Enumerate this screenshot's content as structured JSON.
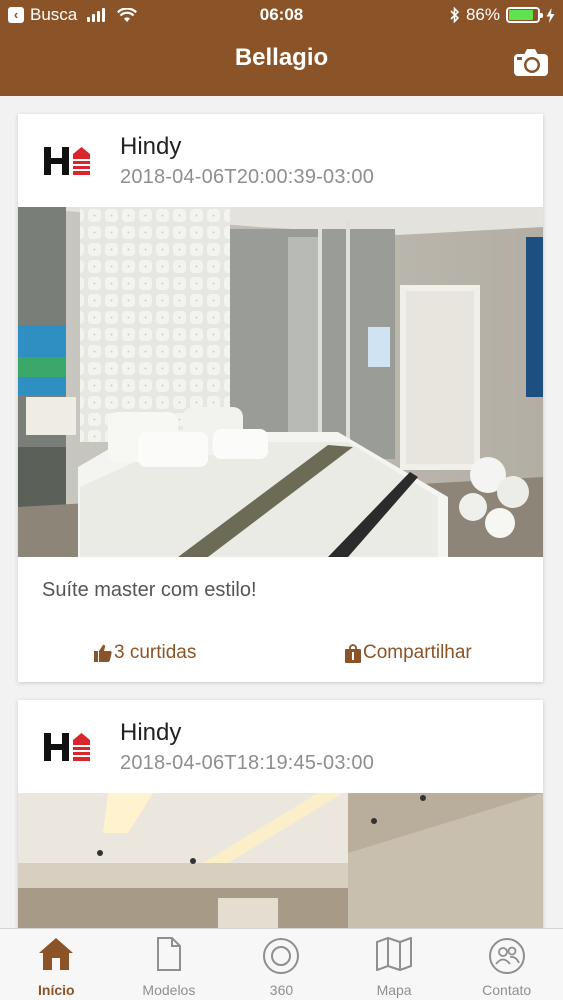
{
  "status_bar": {
    "carrier": "Busca",
    "time": "06:08",
    "battery_percent": "86%",
    "battery_level": 0.86
  },
  "header": {
    "title": "Bellagio",
    "camera_icon": "camera-icon"
  },
  "posts": [
    {
      "author": "Hindy",
      "date": "2018-04-06T20:00:39-03:00",
      "caption": "Suíte master com estilo!",
      "likes_label": "3 curtidas",
      "share_label": "Compartilhar"
    },
    {
      "author": "Hindy",
      "date": "2018-04-06T18:19:45-03:00"
    }
  ],
  "tabs": [
    {
      "label": "Início",
      "icon": "home-icon",
      "active": true
    },
    {
      "label": "Modelos",
      "icon": "document-icon",
      "active": false
    },
    {
      "label": "360",
      "icon": "target-icon",
      "active": false
    },
    {
      "label": "Mapa",
      "icon": "map-icon",
      "active": false
    },
    {
      "label": "Contato",
      "icon": "contacts-icon",
      "active": false
    }
  ],
  "colors": {
    "brand": "#8b5428",
    "background": "#f2f2f2",
    "tab_inactive": "#8f8f8f",
    "logo_red": "#d9262c"
  }
}
